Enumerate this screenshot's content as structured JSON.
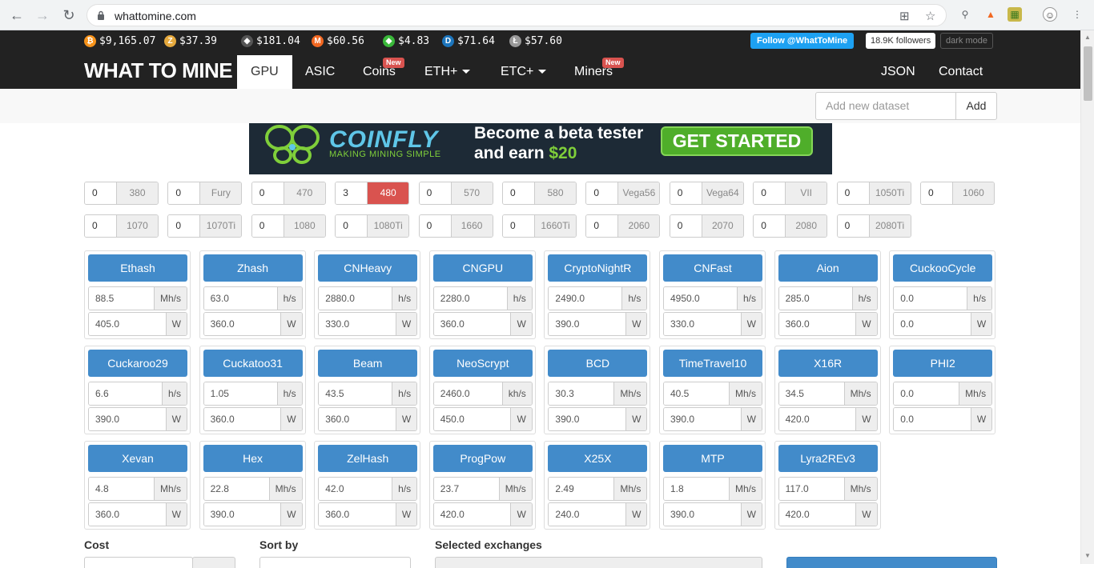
{
  "browser": {
    "url": "whattomine.com"
  },
  "ticker": [
    {
      "symbol": "BTC",
      "price": "$9,165.07",
      "color": "#f7931a",
      "glyph": "₿"
    },
    {
      "symbol": "ZEC",
      "price": "$37.39",
      "color": "#e5a93d",
      "glyph": "Z"
    },
    {
      "symbol": "ETH",
      "price": "$181.04",
      "color": "#555555",
      "glyph": "◆"
    },
    {
      "symbol": "XMR",
      "price": "$60.56",
      "color": "#f26822",
      "glyph": "M"
    },
    {
      "symbol": "ETC",
      "price": "$4.83",
      "color": "#3ab83a",
      "glyph": "◆"
    },
    {
      "symbol": "DASH",
      "price": "$71.64",
      "color": "#1c75bc",
      "glyph": "D"
    },
    {
      "symbol": "LTC",
      "price": "$57.60",
      "color": "#999999",
      "glyph": "Ł"
    }
  ],
  "social": {
    "twitter": "Follow @WhatToMine",
    "followers": "18.9K followers",
    "darkmode": "dark mode"
  },
  "brand": "WHAT TO MINE",
  "nav": [
    {
      "label": "GPU",
      "active": true,
      "badge": ""
    },
    {
      "label": "ASIC",
      "badge": ""
    },
    {
      "label": "Coins",
      "badge": "New"
    },
    {
      "label": "ETH+",
      "badge": ""
    },
    {
      "label": "ETC+",
      "badge": ""
    },
    {
      "label": "Miners",
      "badge": "New"
    },
    {
      "label": "JSON",
      "badge": ""
    },
    {
      "label": "Contact",
      "badge": ""
    }
  ],
  "dataset": {
    "placeholder": "Add new dataset",
    "add": "Add"
  },
  "banner": {
    "logo": "COINFLY",
    "tagline": "MAKING MINING SIMPLE",
    "line1": "Become a beta tester",
    "line2": "and earn ",
    "amount": "$20",
    "cta": "GET STARTED"
  },
  "gpus": [
    {
      "count": "0",
      "name": "380"
    },
    {
      "count": "0",
      "name": "Fury"
    },
    {
      "count": "0",
      "name": "470"
    },
    {
      "count": "3",
      "name": "480",
      "selected": true
    },
    {
      "count": "0",
      "name": "570"
    },
    {
      "count": "0",
      "name": "580"
    },
    {
      "count": "0",
      "name": "Vega56"
    },
    {
      "count": "0",
      "name": "Vega64"
    },
    {
      "count": "0",
      "name": "VII"
    },
    {
      "count": "0",
      "name": "1050Ti"
    },
    {
      "count": "0",
      "name": "1060"
    },
    {
      "count": "0",
      "name": "1070"
    },
    {
      "count": "0",
      "name": "1070Ti"
    },
    {
      "count": "0",
      "name": "1080"
    },
    {
      "count": "0",
      "name": "1080Ti"
    },
    {
      "count": "0",
      "name": "1660"
    },
    {
      "count": "0",
      "name": "1660Ti"
    },
    {
      "count": "0",
      "name": "2060"
    },
    {
      "count": "0",
      "name": "2070"
    },
    {
      "count": "0",
      "name": "2080"
    },
    {
      "count": "0",
      "name": "2080Ti"
    }
  ],
  "algorithms": [
    {
      "name": "Ethash",
      "hashrate": "88.5",
      "unit": "Mh/s",
      "power": "405.0"
    },
    {
      "name": "Zhash",
      "hashrate": "63.0",
      "unit": "h/s",
      "power": "360.0"
    },
    {
      "name": "CNHeavy",
      "hashrate": "2880.0",
      "unit": "h/s",
      "power": "330.0"
    },
    {
      "name": "CNGPU",
      "hashrate": "2280.0",
      "unit": "h/s",
      "power": "360.0"
    },
    {
      "name": "CryptoNightR",
      "hashrate": "2490.0",
      "unit": "h/s",
      "power": "390.0"
    },
    {
      "name": "CNFast",
      "hashrate": "4950.0",
      "unit": "h/s",
      "power": "330.0"
    },
    {
      "name": "Aion",
      "hashrate": "285.0",
      "unit": "h/s",
      "power": "360.0"
    },
    {
      "name": "CuckooCycle",
      "hashrate": "0.0",
      "unit": "h/s",
      "power": "0.0"
    },
    {
      "name": "Cuckaroo29",
      "hashrate": "6.6",
      "unit": "h/s",
      "power": "390.0"
    },
    {
      "name": "Cuckatoo31",
      "hashrate": "1.05",
      "unit": "h/s",
      "power": "360.0"
    },
    {
      "name": "Beam",
      "hashrate": "43.5",
      "unit": "h/s",
      "power": "360.0"
    },
    {
      "name": "NeoScrypt",
      "hashrate": "2460.0",
      "unit": "kh/s",
      "power": "450.0"
    },
    {
      "name": "BCD",
      "hashrate": "30.3",
      "unit": "Mh/s",
      "power": "390.0"
    },
    {
      "name": "TimeTravel10",
      "hashrate": "40.5",
      "unit": "Mh/s",
      "power": "390.0"
    },
    {
      "name": "X16R",
      "hashrate": "34.5",
      "unit": "Mh/s",
      "power": "420.0"
    },
    {
      "name": "PHI2",
      "hashrate": "0.0",
      "unit": "Mh/s",
      "power": "0.0"
    },
    {
      "name": "Xevan",
      "hashrate": "4.8",
      "unit": "Mh/s",
      "power": "360.0"
    },
    {
      "name": "Hex",
      "hashrate": "22.8",
      "unit": "Mh/s",
      "power": "390.0"
    },
    {
      "name": "ZelHash",
      "hashrate": "42.0",
      "unit": "h/s",
      "power": "360.0"
    },
    {
      "name": "ProgPow",
      "hashrate": "23.7",
      "unit": "Mh/s",
      "power": "420.0"
    },
    {
      "name": "X25X",
      "hashrate": "2.49",
      "unit": "Mh/s",
      "power": "240.0"
    },
    {
      "name": "MTP",
      "hashrate": "1.8",
      "unit": "Mh/s",
      "power": "390.0"
    },
    {
      "name": "Lyra2REv3",
      "hashrate": "117.0",
      "unit": "Mh/s",
      "power": "420.0"
    }
  ],
  "power_unit": "W",
  "footer_labels": {
    "cost": "Cost",
    "sort": "Sort by",
    "exchanges": "Selected exchanges"
  }
}
